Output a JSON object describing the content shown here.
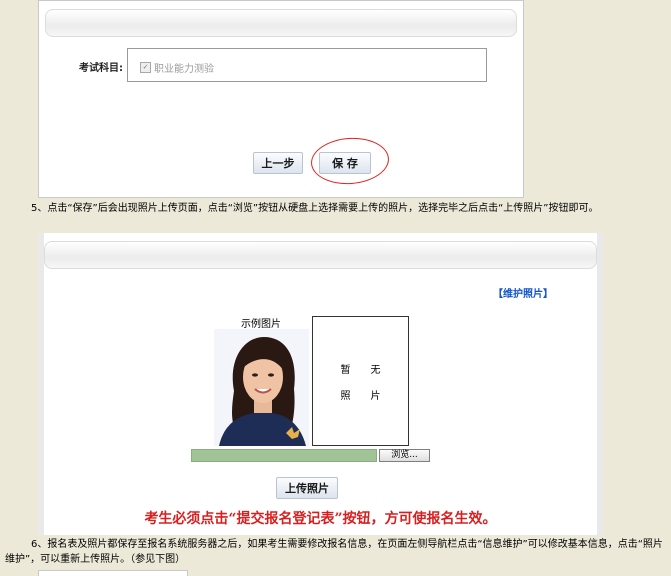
{
  "form_top": {
    "subject_label": "考试科目:",
    "subject_value": "职业能力测验",
    "prev_button": "上一步",
    "save_button": "保  存"
  },
  "instructions": {
    "step5": "5、点击“保存”后会出现照片上传页面，点击“浏览”按钮从硬盘上选择需要上传的照片，选择完毕之后点击“上传照片”按钮即可。",
    "step6": "6、报名表及照片都保存至报名系统服务器之后，如果考生需要修改报名信息，在页面左侧导航栏点击“信息维护”可以修改基本信息，点击“照片维护”，可以重新上传照片。（参见下图）"
  },
  "photo_page": {
    "maintain_link": "【维护照片】",
    "sample_label": "示例图片",
    "no_photo_row1": "暂无",
    "no_photo_row2": "照片",
    "browse_button": "浏览...",
    "upload_button": "上传照片",
    "notice": "考生必须点击“提交报名登记表”按钮，方可使报名生效。"
  },
  "colors": {
    "background": "#ece9d8",
    "notice_red": "#d81e1e",
    "link_blue": "#1155cc",
    "file_field_green": "#a0c397"
  }
}
